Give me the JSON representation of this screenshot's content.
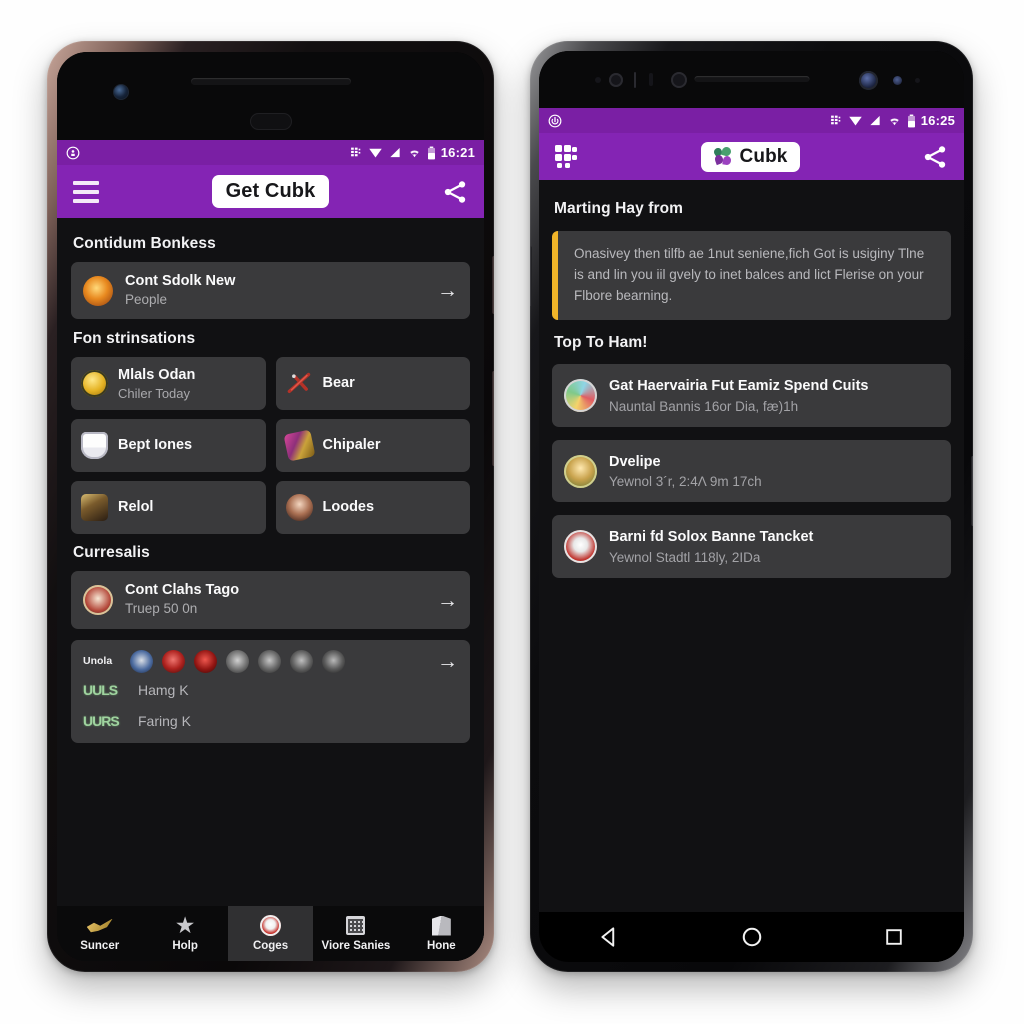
{
  "scene": {
    "background": "#ffffff",
    "accent_purple": "#8424b4",
    "status_purple": "#7a1fa4",
    "card_bg": "#3a3a3c",
    "screen_bg": "#111113",
    "callout_accent": "#f0b429"
  },
  "left_phone": {
    "status_bar": {
      "time": "16:21",
      "icons": [
        "sim-icon",
        "wifi-signal-icon",
        "cell-signal-icon",
        "wifi-icon",
        "battery-icon"
      ]
    },
    "app_bar": {
      "menu_icon": "hamburger-icon",
      "title": "Get Cubk",
      "share_icon": "share-icon"
    },
    "sections": [
      {
        "heading": "Contidum Bonkess",
        "rows": [
          {
            "title": "Cont Sdolk New",
            "subtitle": "People",
            "arrow": "→"
          }
        ]
      },
      {
        "heading": "Fon strinsations",
        "tiles": [
          {
            "label": "Mlals Odan",
            "sub": "Chiler Today",
            "icon": "coin-icon"
          },
          {
            "label": "Bear",
            "sub": "",
            "icon": "plane-icon"
          },
          {
            "label": "Bept Iones",
            "sub": "",
            "icon": "shield-icon"
          },
          {
            "label": "Chipaler",
            "sub": "",
            "icon": "ticket-icon"
          },
          {
            "label": "Relol",
            "sub": "",
            "icon": "rock-icon"
          },
          {
            "label": "Loodes",
            "sub": "",
            "icon": "portrait-icon"
          }
        ]
      },
      {
        "heading": "Curresalis",
        "rows": [
          {
            "title": "Cont Clahs Tago",
            "subtitle": "Truep 50 0n",
            "arrow": "→"
          }
        ],
        "strip": {
          "wordmark": "Unola",
          "arrow": "→",
          "logos": [
            "logo-blob-1",
            "logo-blob-2",
            "logo-blob-3",
            "logo-blob-4",
            "logo-blob-5",
            "logo-blob-6"
          ],
          "items": [
            {
              "mark": "UULS",
              "label": "Hamg K"
            },
            {
              "mark": "UURS",
              "label": "Faring K"
            }
          ]
        }
      }
    ],
    "bottom_nav": [
      {
        "label": "Suncer",
        "icon": "comet-icon",
        "active": false
      },
      {
        "label": "Holp",
        "icon": "star-icon",
        "active": false
      },
      {
        "label": "Coges",
        "icon": "badge-icon",
        "active": true
      },
      {
        "label": "Viore Sanies",
        "icon": "calendar-icon",
        "active": false
      },
      {
        "label": "Hone",
        "icon": "box-icon",
        "active": false
      }
    ]
  },
  "right_phone": {
    "status_bar": {
      "time": "16:25",
      "icons": [
        "sim-icon",
        "wifi-signal-icon",
        "cell-signal-icon",
        "wifi-icon",
        "battery-icon"
      ]
    },
    "app_bar": {
      "menu_icon": "grid-icon",
      "title": "Cubk",
      "share_icon": "share-icon"
    },
    "heading": "Marting Hay from",
    "callout": {
      "text": "Onasivey then tilfb ae 1nut seniene,fich Got is usiginy Tlne is and lin you iil gvely to inet balces and lict Flerise on your Flbore bearning."
    },
    "list_heading": "Top To Ham!",
    "rows": [
      {
        "title": "Gat Haervairia Fut Eamiz Spend Cuits",
        "subtitle": "Nauntal Bannis 16or Dia, fæ)1h",
        "icon": "avatar-colorful"
      },
      {
        "title": "Dvelipe",
        "subtitle": "Yewnol 3´r, 2:4Λ 9m 17ch",
        "icon": "avatar-green"
      },
      {
        "title": "Barni fd Solox Banne Tancket",
        "subtitle": "Yewnol Stadtl 118ly, 2IDa",
        "icon": "avatar-red"
      }
    ],
    "android_nav": {
      "back": "back-triangle-icon",
      "home": "home-circle-icon",
      "recent": "recents-square-icon"
    }
  }
}
